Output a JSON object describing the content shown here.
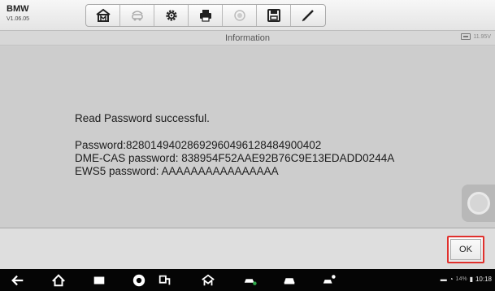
{
  "app": {
    "name": "BMW",
    "version": "V1.06.05"
  },
  "toolbar": {
    "buttons": [
      {
        "name": "home-icon"
      },
      {
        "name": "vehicle-swap-icon"
      },
      {
        "name": "settings-icon"
      },
      {
        "name": "print-icon"
      },
      {
        "name": "help-icon"
      },
      {
        "name": "save-icon"
      },
      {
        "name": "edit-icon"
      }
    ]
  },
  "header": {
    "title": "Information",
    "battery_voltage": "11.95V"
  },
  "message": {
    "line1": "Read Password successful.",
    "line2": "Password:82801494028692960496128484900402",
    "line3": "DME-CAS password: 838954F52AAE92B76C9E13EDADD0244A",
    "line4": "EWS5 password: AAAAAAAAAAAAAAAA"
  },
  "actions": {
    "ok_label": "OK"
  },
  "statusbar": {
    "battery_percent": "14%",
    "time": "10:18"
  },
  "colors": {
    "accent_red": "#e0302c",
    "navbar": "#050505"
  }
}
